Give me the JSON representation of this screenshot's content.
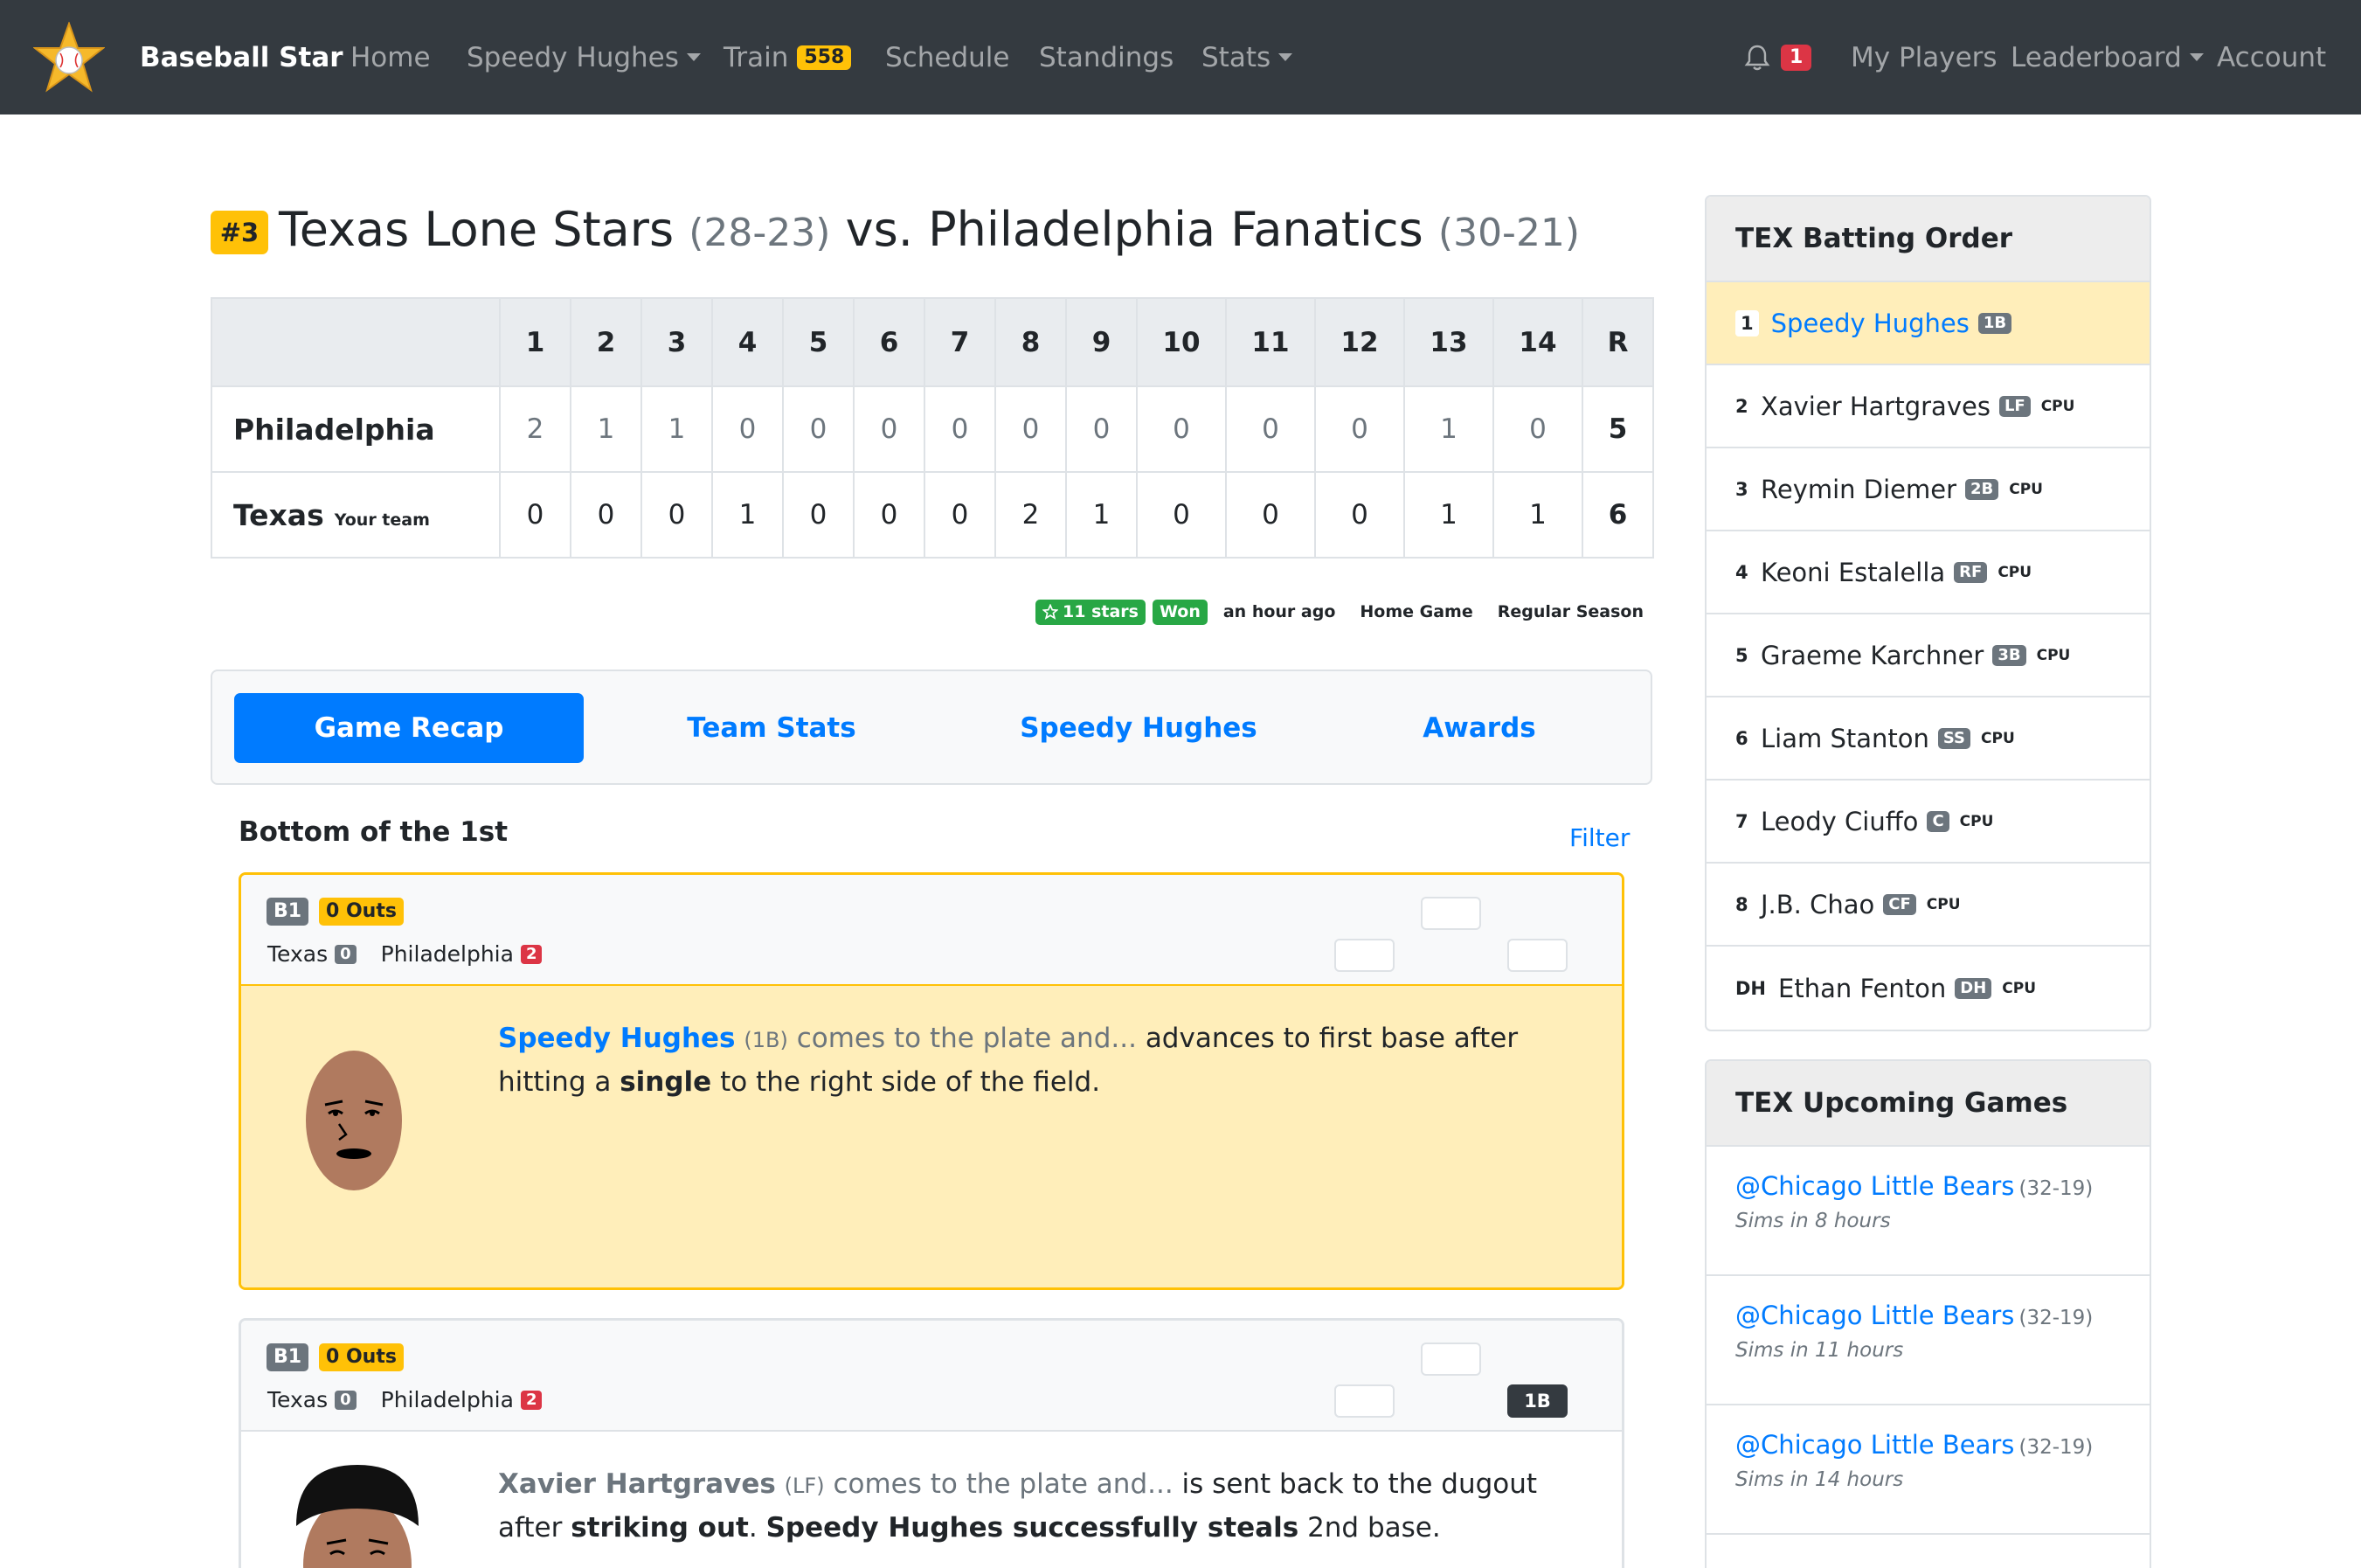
{
  "nav": {
    "brand": "Baseball Star",
    "home": "Home",
    "player": "Speedy Hughes",
    "train": "Train",
    "train_count": "558",
    "schedule": "Schedule",
    "standings": "Standings",
    "stats": "Stats",
    "notif_count": "1",
    "my_players": "My Players",
    "leaderboard": "Leaderboard",
    "account": "Account"
  },
  "game": {
    "rank": "#3",
    "home_team": "Texas Lone Stars",
    "home_record": "(28-23)",
    "vs": "vs.",
    "away_team": "Philadelphia Fanatics",
    "away_record": "(30-21)"
  },
  "linescore": {
    "innings": [
      "1",
      "2",
      "3",
      "4",
      "5",
      "6",
      "7",
      "8",
      "9",
      "10",
      "11",
      "12",
      "13",
      "14"
    ],
    "total_label": "R",
    "rows": [
      {
        "team": "Philadelphia",
        "tag": "",
        "scores": [
          "2",
          "1",
          "1",
          "0",
          "0",
          "0",
          "0",
          "0",
          "0",
          "0",
          "0",
          "0",
          "1",
          "0"
        ],
        "total": "5"
      },
      {
        "team": "Texas",
        "tag": "Your team",
        "scores": [
          "0",
          "0",
          "0",
          "1",
          "0",
          "0",
          "0",
          "2",
          "1",
          "0",
          "0",
          "0",
          "1",
          "1"
        ],
        "total": "6"
      }
    ]
  },
  "meta": {
    "stars": "11 stars",
    "result": "Won",
    "time": "an hour ago",
    "location": "Home Game",
    "season": "Regular Season"
  },
  "tabs": [
    "Game Recap",
    "Team Stats",
    "Speedy Hughes",
    "Awards"
  ],
  "recap": {
    "inning_title": "Bottom of the 1st",
    "filter": "Filter",
    "plays": [
      {
        "inning": "B1",
        "outs": "0 Outs",
        "team_a": "Texas",
        "score_a": "0",
        "team_b": "Philadelphia",
        "score_b": "2",
        "first_base": "",
        "batter": "Speedy Hughes",
        "batter_pos": "(1B)",
        "lead": "comes to the plate and...",
        "t1": "advances to first base after hitting a",
        "b1": "single",
        "t2": "to the right side of the field."
      },
      {
        "inning": "B1",
        "outs": "0 Outs",
        "team_a": "Texas",
        "score_a": "0",
        "team_b": "Philadelphia",
        "score_b": "2",
        "first_base": "1B",
        "batter": "Xavier Hartgraves",
        "batter_pos": "(LF)",
        "lead": "comes to the plate and...",
        "t1": "is sent back to the dugout after",
        "b1": "striking out",
        "t2": ".",
        "b2": "Speedy Hughes successfully steals",
        "t3": "2nd base."
      }
    ]
  },
  "batting_order": {
    "title": "TEX Batting Order",
    "cpu_label": "CPU",
    "players": [
      {
        "num": "1",
        "name": "Speedy Hughes",
        "pos": "1B",
        "cpu": ""
      },
      {
        "num": "2",
        "name": "Xavier Hartgraves",
        "pos": "LF",
        "cpu": "CPU"
      },
      {
        "num": "3",
        "name": "Reymin Diemer",
        "pos": "2B",
        "cpu": "CPU"
      },
      {
        "num": "4",
        "name": "Keoni Estalella",
        "pos": "RF",
        "cpu": "CPU"
      },
      {
        "num": "5",
        "name": "Graeme Karchner",
        "pos": "3B",
        "cpu": "CPU"
      },
      {
        "num": "6",
        "name": "Liam Stanton",
        "pos": "SS",
        "cpu": "CPU"
      },
      {
        "num": "7",
        "name": "Leody Ciuffo",
        "pos": "C",
        "cpu": "CPU"
      },
      {
        "num": "8",
        "name": "J.B. Chao",
        "pos": "CF",
        "cpu": "CPU"
      },
      {
        "num": "DH",
        "name": "Ethan Fenton",
        "pos": "DH",
        "cpu": "CPU"
      }
    ]
  },
  "upcoming": {
    "title": "TEX Upcoming Games",
    "games": [
      {
        "opponent": "@Chicago Little Bears",
        "record": "(32-19)",
        "when": "Sims in 8 hours"
      },
      {
        "opponent": "@Chicago Little Bears",
        "record": "(32-19)",
        "when": "Sims in 11 hours"
      },
      {
        "opponent": "@Chicago Little Bears",
        "record": "(32-19)",
        "when": "Sims in 14 hours"
      }
    ]
  },
  "colors": {
    "navbar": "#343a40",
    "primary": "#007bff",
    "warning": "#ffc107",
    "danger": "#dc3545",
    "success": "#28a745",
    "highlight": "#ffeeba"
  },
  "icons": {
    "brand": "baseball-star-logo",
    "notifications": "bell-icon",
    "stars": "star-outline-icon",
    "avatar": "player-avatar-face"
  }
}
